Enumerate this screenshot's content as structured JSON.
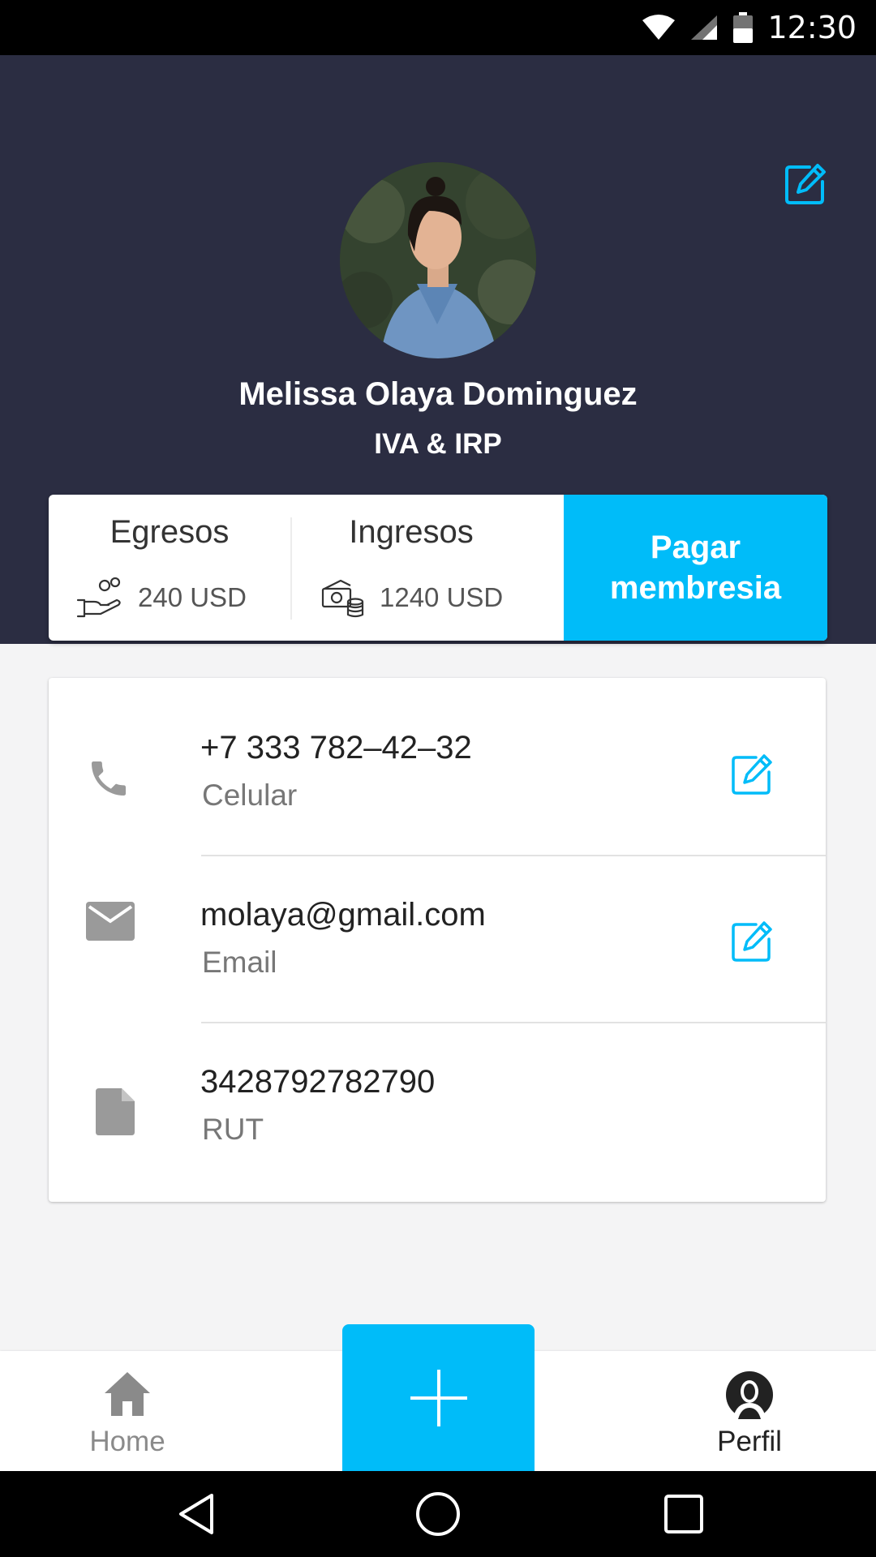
{
  "status_bar": {
    "time": "12:30",
    "icons": [
      "wifi-icon",
      "signal-icon",
      "battery-icon"
    ]
  },
  "profile": {
    "name": "Melissa Olaya Dominguez",
    "tax_regime": "IVA & IRP",
    "edit_icon": "edit-icon"
  },
  "stats": {
    "egresos": {
      "title": "Egresos",
      "value": "240 USD",
      "icon": "hand-coins-icon"
    },
    "ingresos": {
      "title": "Ingresos",
      "value": "1240 USD",
      "icon": "cash-stack-icon"
    },
    "pay_button": "Pagar membresia"
  },
  "contact": {
    "items": [
      {
        "value": "+7 333 782–42–32",
        "label": "Celular",
        "icon": "phone-icon",
        "editable": true
      },
      {
        "value": "molaya@gmail.com",
        "label": "Email",
        "icon": "mail-icon",
        "editable": true
      },
      {
        "value": "3428792782790",
        "label": "RUT",
        "icon": "document-icon",
        "editable": false
      }
    ]
  },
  "bottom_nav": {
    "home": {
      "label": "Home",
      "icon": "home-icon"
    },
    "add": {
      "icon": "plus-icon"
    },
    "perfil": {
      "label": "Perfil",
      "icon": "user-icon",
      "active": true
    }
  },
  "system_nav": [
    "back-icon",
    "home-circle-icon",
    "recents-icon"
  ],
  "colors": {
    "header_bg": "#2b2d42",
    "accent": "#00bcf9",
    "background": "#f4f4f5"
  }
}
